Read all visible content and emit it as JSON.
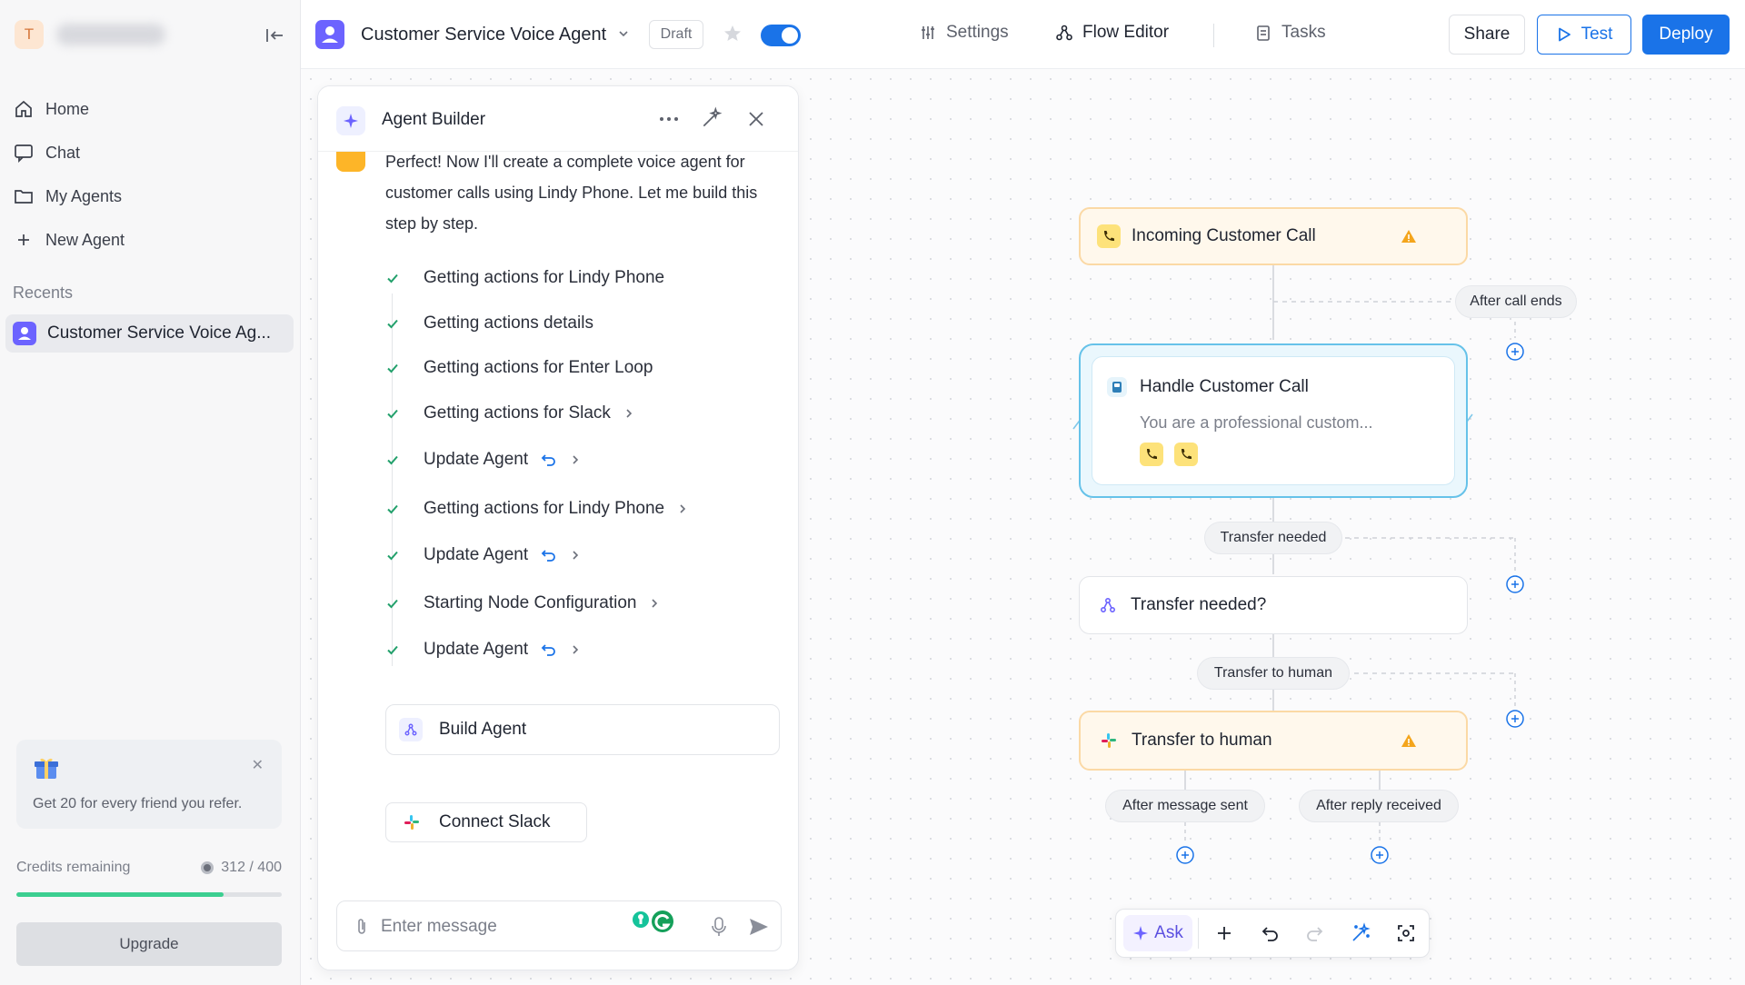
{
  "workspace": {
    "avatar_letter": "T"
  },
  "sidebar": {
    "nav": [
      {
        "label": "Home",
        "icon": "home-icon"
      },
      {
        "label": "Chat",
        "icon": "chat-icon"
      },
      {
        "label": "My Agents",
        "icon": "folder-icon"
      },
      {
        "label": "New Agent",
        "icon": "plus-icon"
      }
    ],
    "recents_label": "Recents",
    "recent_item": "Customer Service Voice Ag...",
    "refer_text": "Get 20 for every friend you refer.",
    "credits_label": "Credits remaining",
    "credits_value": "312 / 400",
    "credits_fraction": 0.78,
    "upgrade_label": "Upgrade"
  },
  "topbar": {
    "agent_title": "Customer Service Voice Agent",
    "draft_label": "Draft",
    "tabs": [
      {
        "label": "Settings",
        "icon": "sliders-icon"
      },
      {
        "label": "Flow Editor",
        "icon": "flow-icon"
      },
      {
        "label": "Tasks",
        "icon": "tasks-icon"
      }
    ],
    "share_label": "Share",
    "test_label": "Test",
    "deploy_label": "Deploy"
  },
  "builder": {
    "title": "Agent Builder",
    "message": "Perfect! Now I'll create a complete voice agent for customer calls using Lindy Phone. Let me build this step by step.",
    "steps": [
      {
        "label": "Getting actions for Lindy Phone"
      },
      {
        "label": "Getting actions details"
      },
      {
        "label": "Getting actions for Enter Loop"
      },
      {
        "label": "Getting actions for Slack"
      },
      {
        "label": "Update Agent"
      },
      {
        "label": "Getting actions for Lindy Phone"
      },
      {
        "label": "Update Agent"
      },
      {
        "label": "Starting Node Configuration"
      },
      {
        "label": "Update Agent"
      }
    ],
    "build_agent_label": "Build Agent",
    "connect_slack_label": "Connect Slack",
    "input_placeholder": "Enter message"
  },
  "flow": {
    "incoming_call": "Incoming Customer Call",
    "after_call_ends": "After call ends",
    "handle_title": "Handle Customer Call",
    "handle_desc": "You are a professional custom...",
    "transfer_needed_pill": "Transfer needed",
    "transfer_needed_node": "Transfer needed?",
    "transfer_to_human_pill": "Transfer to human",
    "transfer_to_human_node": "Transfer to human",
    "after_message_sent": "After message sent",
    "after_reply_received": "After reply received"
  },
  "toolbar": {
    "ask_label": "Ask"
  },
  "colors": {
    "accent": "#1a73e8",
    "warning": "#f4a51c",
    "success": "#3ccf91",
    "handle_border": "#66c2e9"
  }
}
